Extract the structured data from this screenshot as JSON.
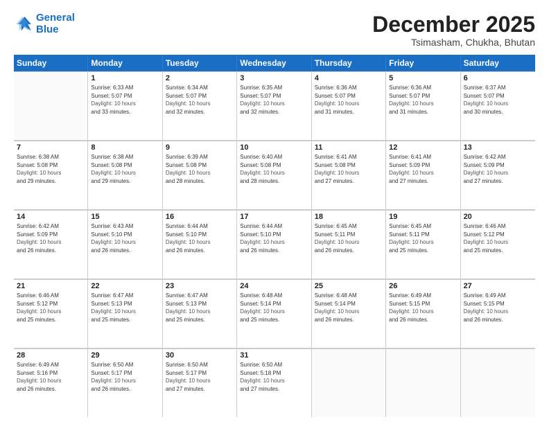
{
  "logo": {
    "line1": "General",
    "line2": "Blue"
  },
  "title": "December 2025",
  "subtitle": "Tsimasham, Chukha, Bhutan",
  "headers": [
    "Sunday",
    "Monday",
    "Tuesday",
    "Wednesday",
    "Thursday",
    "Friday",
    "Saturday"
  ],
  "weeks": [
    [
      {
        "day": "",
        "info": ""
      },
      {
        "day": "1",
        "info": "Sunrise: 6:33 AM\nSunset: 5:07 PM\nDaylight: 10 hours\nand 33 minutes."
      },
      {
        "day": "2",
        "info": "Sunrise: 6:34 AM\nSunset: 5:07 PM\nDaylight: 10 hours\nand 32 minutes."
      },
      {
        "day": "3",
        "info": "Sunrise: 6:35 AM\nSunset: 5:07 PM\nDaylight: 10 hours\nand 32 minutes."
      },
      {
        "day": "4",
        "info": "Sunrise: 6:36 AM\nSunset: 5:07 PM\nDaylight: 10 hours\nand 31 minutes."
      },
      {
        "day": "5",
        "info": "Sunrise: 6:36 AM\nSunset: 5:07 PM\nDaylight: 10 hours\nand 31 minutes."
      },
      {
        "day": "6",
        "info": "Sunrise: 6:37 AM\nSunset: 5:07 PM\nDaylight: 10 hours\nand 30 minutes."
      }
    ],
    [
      {
        "day": "7",
        "info": "Sunrise: 6:38 AM\nSunset: 5:08 PM\nDaylight: 10 hours\nand 29 minutes."
      },
      {
        "day": "8",
        "info": "Sunrise: 6:38 AM\nSunset: 5:08 PM\nDaylight: 10 hours\nand 29 minutes."
      },
      {
        "day": "9",
        "info": "Sunrise: 6:39 AM\nSunset: 5:08 PM\nDaylight: 10 hours\nand 28 minutes."
      },
      {
        "day": "10",
        "info": "Sunrise: 6:40 AM\nSunset: 5:08 PM\nDaylight: 10 hours\nand 28 minutes."
      },
      {
        "day": "11",
        "info": "Sunrise: 6:41 AM\nSunset: 5:08 PM\nDaylight: 10 hours\nand 27 minutes."
      },
      {
        "day": "12",
        "info": "Sunrise: 6:41 AM\nSunset: 5:09 PM\nDaylight: 10 hours\nand 27 minutes."
      },
      {
        "day": "13",
        "info": "Sunrise: 6:42 AM\nSunset: 5:09 PM\nDaylight: 10 hours\nand 27 minutes."
      }
    ],
    [
      {
        "day": "14",
        "info": "Sunrise: 6:42 AM\nSunset: 5:09 PM\nDaylight: 10 hours\nand 26 minutes."
      },
      {
        "day": "15",
        "info": "Sunrise: 6:43 AM\nSunset: 5:10 PM\nDaylight: 10 hours\nand 26 minutes."
      },
      {
        "day": "16",
        "info": "Sunrise: 6:44 AM\nSunset: 5:10 PM\nDaylight: 10 hours\nand 26 minutes."
      },
      {
        "day": "17",
        "info": "Sunrise: 6:44 AM\nSunset: 5:10 PM\nDaylight: 10 hours\nand 26 minutes."
      },
      {
        "day": "18",
        "info": "Sunrise: 6:45 AM\nSunset: 5:11 PM\nDaylight: 10 hours\nand 26 minutes."
      },
      {
        "day": "19",
        "info": "Sunrise: 6:45 AM\nSunset: 5:11 PM\nDaylight: 10 hours\nand 25 minutes."
      },
      {
        "day": "20",
        "info": "Sunrise: 6:46 AM\nSunset: 5:12 PM\nDaylight: 10 hours\nand 25 minutes."
      }
    ],
    [
      {
        "day": "21",
        "info": "Sunrise: 6:46 AM\nSunset: 5:12 PM\nDaylight: 10 hours\nand 25 minutes."
      },
      {
        "day": "22",
        "info": "Sunrise: 6:47 AM\nSunset: 5:13 PM\nDaylight: 10 hours\nand 25 minutes."
      },
      {
        "day": "23",
        "info": "Sunrise: 6:47 AM\nSunset: 5:13 PM\nDaylight: 10 hours\nand 25 minutes."
      },
      {
        "day": "24",
        "info": "Sunrise: 6:48 AM\nSunset: 5:14 PM\nDaylight: 10 hours\nand 25 minutes."
      },
      {
        "day": "25",
        "info": "Sunrise: 6:48 AM\nSunset: 5:14 PM\nDaylight: 10 hours\nand 26 minutes."
      },
      {
        "day": "26",
        "info": "Sunrise: 6:49 AM\nSunset: 5:15 PM\nDaylight: 10 hours\nand 26 minutes."
      },
      {
        "day": "27",
        "info": "Sunrise: 6:49 AM\nSunset: 5:15 PM\nDaylight: 10 hours\nand 26 minutes."
      }
    ],
    [
      {
        "day": "28",
        "info": "Sunrise: 6:49 AM\nSunset: 5:16 PM\nDaylight: 10 hours\nand 26 minutes."
      },
      {
        "day": "29",
        "info": "Sunrise: 6:50 AM\nSunset: 5:17 PM\nDaylight: 10 hours\nand 26 minutes."
      },
      {
        "day": "30",
        "info": "Sunrise: 6:50 AM\nSunset: 5:17 PM\nDaylight: 10 hours\nand 27 minutes."
      },
      {
        "day": "31",
        "info": "Sunrise: 6:50 AM\nSunset: 5:18 PM\nDaylight: 10 hours\nand 27 minutes."
      },
      {
        "day": "",
        "info": ""
      },
      {
        "day": "",
        "info": ""
      },
      {
        "day": "",
        "info": ""
      }
    ]
  ]
}
